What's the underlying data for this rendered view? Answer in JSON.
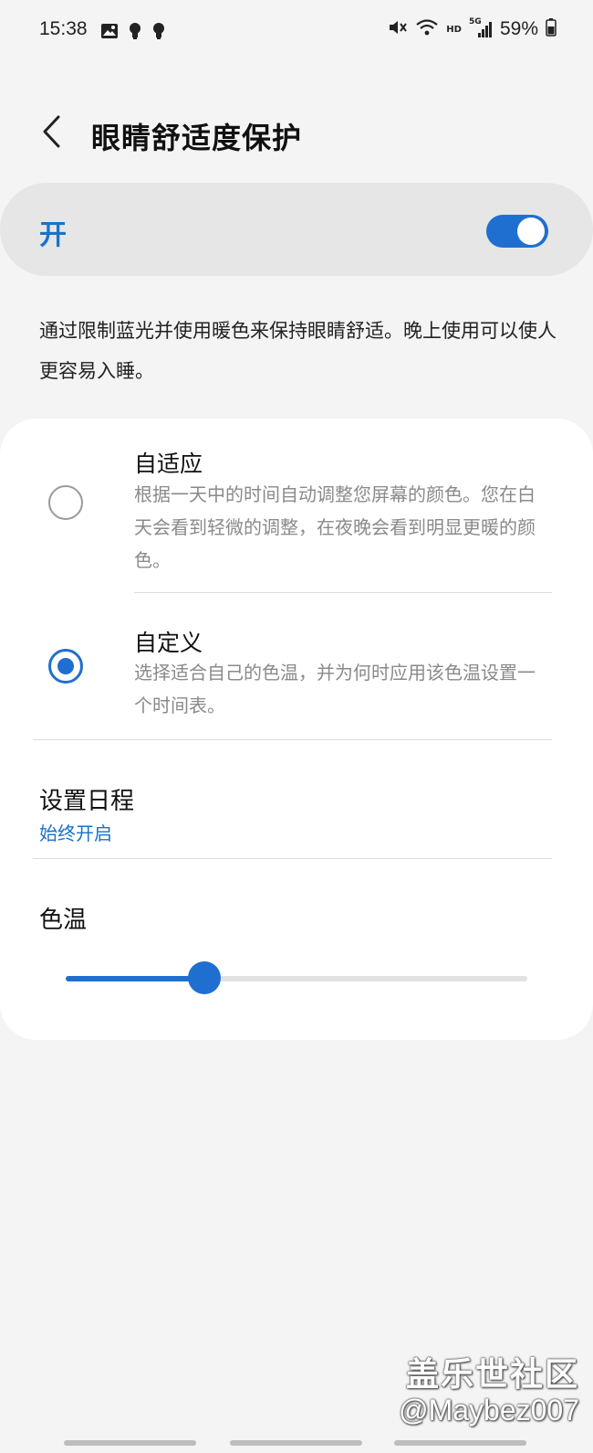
{
  "status_bar": {
    "time": "15:38",
    "hd_label": "HD",
    "network_label": "5G",
    "battery": "59%"
  },
  "header": {
    "title": "眼睛舒适度保护"
  },
  "master_switch": {
    "label": "开",
    "enabled": true
  },
  "description": "通过限制蓝光并使用暖色来保持眼睛舒适。晚上使用可以使人更容易入睡。",
  "options": [
    {
      "title": "自适应",
      "description": "根据一天中的时间自动调整您屏幕的颜色。您在白天会看到轻微的调整，在夜晚会看到明显更暖的颜色。",
      "selected": false
    },
    {
      "title": "自定义",
      "description": "选择适合自己的色温，并为何时应用该色温设置一个时间表。",
      "selected": true
    }
  ],
  "schedule": {
    "title": "设置日程",
    "value": "始终开启"
  },
  "color_temperature": {
    "title": "色温",
    "level_fraction": 0.3
  },
  "watermark": {
    "line1": "盖乐世社区",
    "line2": "@Maybez007"
  },
  "colors": {
    "accent": "#1f6fd1",
    "link": "#1a73c8",
    "background": "#f4f4f4",
    "card": "#ffffff"
  }
}
